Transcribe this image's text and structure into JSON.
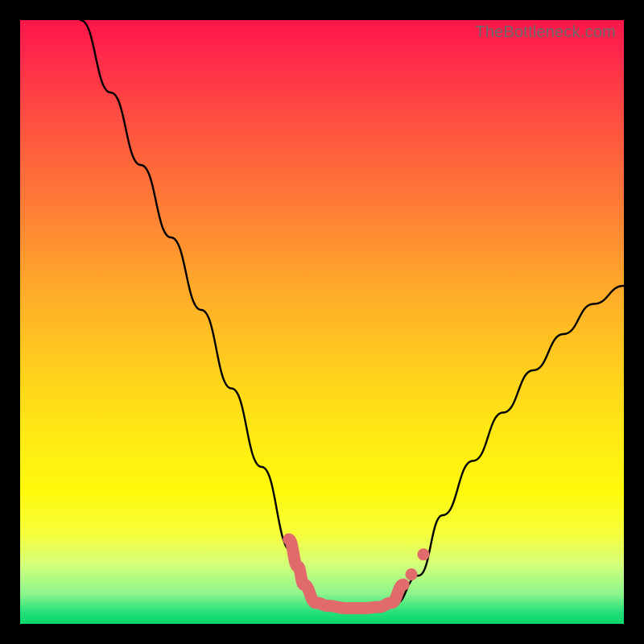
{
  "watermark": "TheBottleneck.com",
  "colors": {
    "curve": "#000000",
    "highlight": "#e16a6a",
    "background_top": "#ff1549",
    "background_bottom": "#0ad66a",
    "frame": "#000000"
  },
  "chart_data": {
    "type": "line",
    "title": "",
    "xlabel": "",
    "ylabel": "",
    "xlim": [
      0,
      100
    ],
    "ylim": [
      0,
      100
    ],
    "grid": false,
    "legend": false,
    "annotations": [
      "TheBottleneck.com"
    ],
    "note": "V-shaped bottleneck curve over vertical spectrum gradient (red=high bottleneck at top, green=low at bottom). No numeric axis ticks or labels are shown; x/y units are percentage of plot width/height. Values below are estimated from pixel positions.",
    "series": [
      {
        "name": "bottleneck-curve",
        "x": [
          10,
          15,
          20,
          25,
          30,
          35,
          40,
          45,
          47,
          50,
          53,
          57,
          60,
          62,
          66,
          70,
          75,
          80,
          85,
          90,
          95,
          100
        ],
        "values": [
          100,
          88,
          76,
          64,
          52,
          39,
          26,
          12,
          6.5,
          3.2,
          2.5,
          2.5,
          2.7,
          3.2,
          8,
          18,
          27,
          35,
          42,
          48,
          53,
          56
        ]
      },
      {
        "name": "highlight-band",
        "note": "Salmon-colored thick band marking the near-zero bottleneck region at the bottom of the V.",
        "x": [
          44.5,
          46,
          47,
          49,
          51,
          54,
          57,
          59.5,
          61.5,
          63.5
        ],
        "values": [
          14,
          9.5,
          6.5,
          3.5,
          3.0,
          2.6,
          2.6,
          2.8,
          3.5,
          6.5
        ]
      }
    ]
  }
}
